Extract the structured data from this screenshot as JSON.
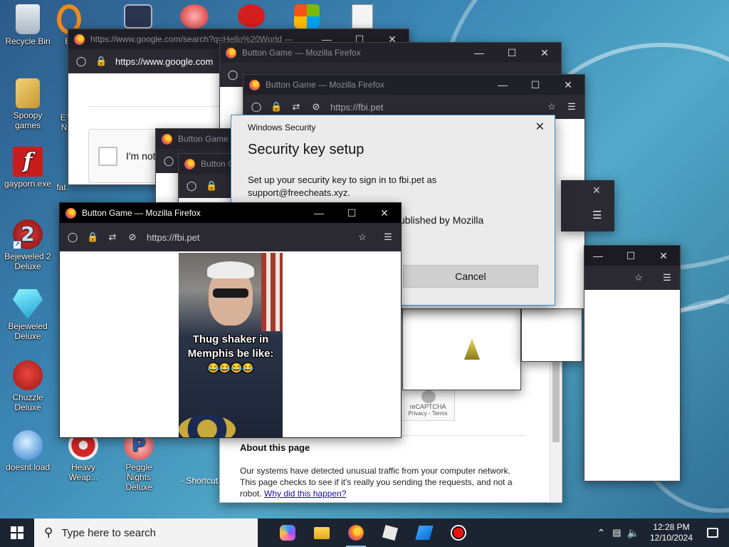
{
  "desktop": {
    "icons": [
      {
        "label": "Recycle Bin",
        "icon": "recycle-bin-icon"
      },
      {
        "label": "Spoopy games",
        "icon": "folder-icon"
      },
      {
        "label": "gayporn.exe",
        "icon": "flash-icon"
      },
      {
        "label": "Bejeweled 2 Deluxe",
        "icon": "bejeweled2-icon"
      },
      {
        "label": "Bejeweled Deluxe",
        "icon": "bejeweled-icon"
      },
      {
        "label": "Chuzzle Deluxe",
        "icon": "chuzzle-icon"
      },
      {
        "label": "doesnt load",
        "icon": "thunderbird-icon"
      },
      {
        "label": "Heavy Weap...",
        "icon": "heavy-weapon-icon"
      },
      {
        "label": "Peggle Nights Deluxe",
        "icon": "peggle-icon"
      },
      {
        "label": "E",
        "icon": "orange-ring-icon"
      },
      {
        "label": "E’ N",
        "icon": "partial-icon"
      },
      {
        "label": "fat",
        "icon": "partial-icon"
      },
      {
        "label": "- Shortcut",
        "icon": "shortcut-icon"
      }
    ]
  },
  "windows": {
    "google": {
      "title": "https://www.google.com/search?q=Hello%20World —",
      "url": "https://www.google.com",
      "captcha_label": "I'm not",
      "recaptcha_brand": "reCAPTCHA",
      "recaptcha_links": "Privacy - Terms",
      "about_heading": "About this page",
      "about_text": "Our systems have detected unusual traffic from your computer network. This page checks to see if it's really you sending the requests, and not a robot.",
      "about_link": "Why did this happen?"
    },
    "bg1": {
      "title": "Button Game — Mozilla Firefox"
    },
    "bg2": {
      "title": "Button Game — Mozilla Firefox",
      "url": "https://fbi.pet"
    },
    "bg3": {
      "title": "Button Game —"
    },
    "bg4": {
      "title": "Button G"
    },
    "front": {
      "title": "Button Game — Mozilla Firefox",
      "url": "https://fbi.pet",
      "meme_line1": "Thug shaker in",
      "meme_line2": "Memphis be like:",
      "meme_emoji": "😂😂😂😂"
    }
  },
  "dialog": {
    "window_title": "Windows Security",
    "heading": "Security key setup",
    "body": "Set up your security key to sign in to fbi.pet as support@freecheats.xyz.",
    "publisher": "ublished by Mozilla",
    "cancel": "Cancel"
  },
  "taskbar": {
    "search_placeholder": "Type here to search",
    "time": "12:28 PM",
    "date": "12/10/2024"
  }
}
